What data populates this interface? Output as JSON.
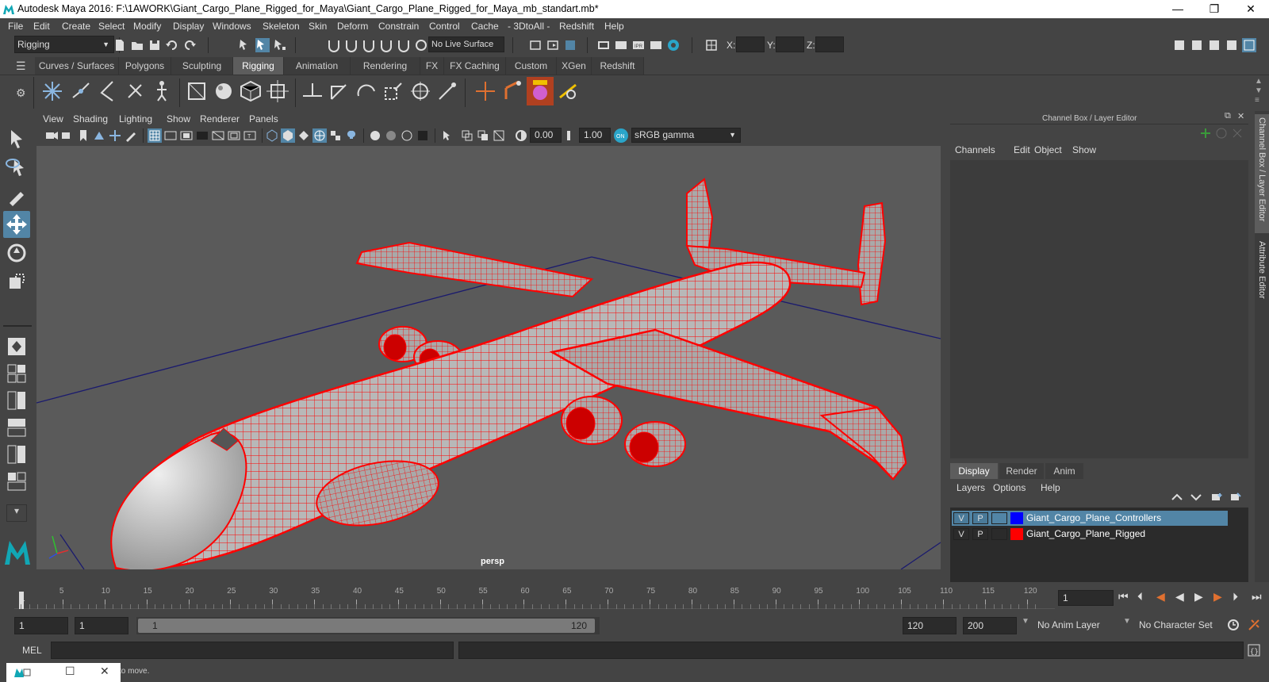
{
  "window": {
    "title": "Autodesk Maya 2016: F:\\1AWORK\\Giant_Cargo_Plane_Rigged_for_Maya\\Giant_Cargo_Plane_Rigged_for_Maya_mb_standart.mb*",
    "minimize": "—",
    "restore": "❐",
    "close": "✕"
  },
  "menubar": [
    "File",
    "Edit",
    "Create",
    "Select",
    "Modify",
    "Display",
    "Windows",
    "Skeleton",
    "Skin",
    "Deform",
    "Constrain",
    "Control",
    "Cache",
    "- 3DtoAll -",
    "Redshift",
    "Help"
  ],
  "statusline": {
    "menuset": "Rigging",
    "live_surface": "No Live Surface",
    "x_label": "X:",
    "y_label": "Y:",
    "z_label": "Z:"
  },
  "shelf_tabs": [
    "Curves / Surfaces",
    "Polygons",
    "Sculpting",
    "Rigging",
    "Animation",
    "Rendering",
    "FX",
    "FX Caching",
    "Custom",
    "XGen",
    "Redshift"
  ],
  "shelf_active": "Rigging",
  "viewport": {
    "menu": [
      "View",
      "Shading",
      "Lighting",
      "Show",
      "Renderer",
      "Panels"
    ],
    "exposure": "0.00",
    "gamma": "1.00",
    "color_space": "sRGB gamma",
    "camera_label": "persp"
  },
  "channelbox": {
    "title": "Channel Box / Layer Editor",
    "menu": [
      "Channels",
      "Edit",
      "Object",
      "Show"
    ]
  },
  "layer_editor": {
    "tabs": [
      "Display",
      "Render",
      "Anim"
    ],
    "active_tab": "Display",
    "menu": [
      "Layers",
      "Options",
      "Help"
    ],
    "layers": [
      {
        "v": "V",
        "p": "P",
        "color": "#0000ff",
        "name": "Giant_Cargo_Plane_Controllers",
        "selected": true
      },
      {
        "v": "V",
        "p": "P",
        "color": "#ff0000",
        "name": "Giant_Cargo_Plane_Rigged",
        "selected": false
      }
    ]
  },
  "side_tabs": [
    "Channel Box / Layer Editor",
    "Attribute Editor"
  ],
  "timeline": {
    "ticks": [
      "5",
      "10",
      "15",
      "20",
      "25",
      "30",
      "35",
      "40",
      "45",
      "50",
      "55",
      "60",
      "65",
      "70",
      "75",
      "80",
      "85",
      "90",
      "95",
      "100",
      "105",
      "110",
      "115",
      "120"
    ],
    "current_frame_marker": "1",
    "current_frame": "1"
  },
  "range": {
    "start": "1",
    "playback_start": "1",
    "slider_start": "1",
    "slider_end": "120",
    "playback_end": "120",
    "end": "200",
    "anim_layer": "No Anim Layer",
    "character_set": "No Character Set"
  },
  "cmdline": {
    "label": "MEL"
  },
  "helpline": {
    "text": "to move."
  },
  "colors": {
    "wireframe": "#ff0000",
    "selected_layer": "#5285a6",
    "grid_axis": "#1a1a6e"
  }
}
